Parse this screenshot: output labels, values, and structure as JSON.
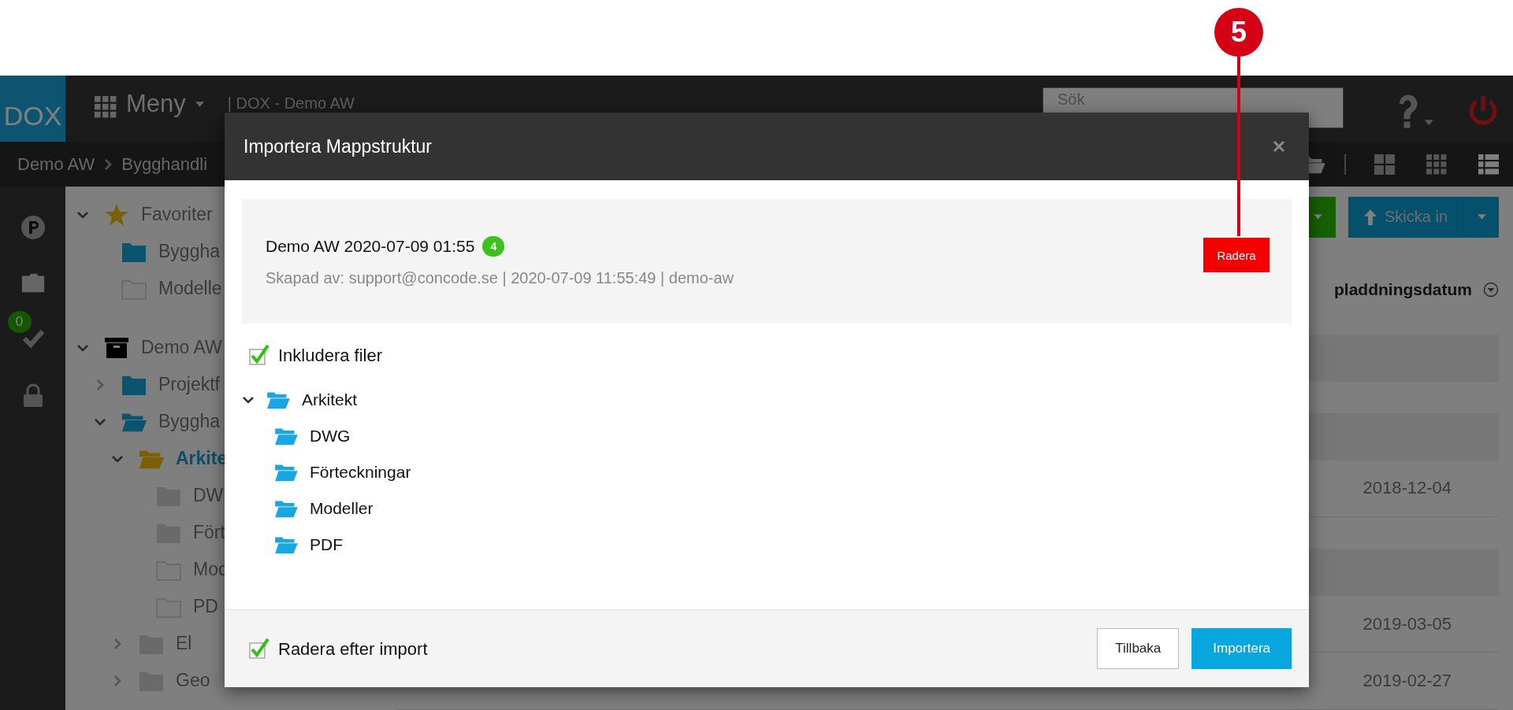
{
  "callout": {
    "label": "5"
  },
  "header": {
    "logo": "DOX",
    "menu": "Meny",
    "title": "| DOX - Demo AW",
    "search": {
      "placeholder": "Sök"
    }
  },
  "breadcrumb": [
    "Demo AW",
    "Bygghandli"
  ],
  "rail": {
    "badge": "0"
  },
  "tree": [
    {
      "name": "Favoriter",
      "kind": "favorites",
      "expanded": true,
      "selected": false,
      "children": [
        {
          "name": "Byggha",
          "kind": "folder-blue",
          "selected": false
        },
        {
          "name": "Modelle",
          "kind": "folder-empty",
          "selected": false
        }
      ]
    },
    {
      "name": "Demo AW",
      "kind": "archive",
      "expanded": true,
      "selected": false,
      "children": [
        {
          "name": "Projektf",
          "kind": "folder-blue",
          "expanded": false,
          "selected": false
        },
        {
          "name": "Byggha",
          "kind": "folder-blue",
          "expanded": true,
          "selected": false,
          "children": [
            {
              "name": "Arkite",
              "kind": "folder-gold",
              "expanded": true,
              "selected": true,
              "children": [
                {
                  "name": "DW",
                  "kind": "folder-grey",
                  "selected": false
                },
                {
                  "name": "Fört",
                  "kind": "folder-grey",
                  "selected": false
                },
                {
                  "name": "Mod",
                  "kind": "folder-empty",
                  "selected": false
                },
                {
                  "name": "PD",
                  "kind": "folder-empty",
                  "selected": false
                }
              ]
            },
            {
              "name": "El",
              "kind": "folder-grey",
              "expanded": false,
              "selected": false
            },
            {
              "name": "Geo",
              "kind": "folder-grey",
              "expanded": false,
              "selected": false
            }
          ]
        }
      ]
    }
  ],
  "toolbar": {
    "submit": "Skicka in"
  },
  "table": {
    "column": "pladdningsdatum",
    "rows": [
      {
        "kind": "group"
      },
      {
        "kind": "group"
      },
      {
        "kind": "file",
        "date": "2018-12-04"
      },
      {
        "kind": "group"
      },
      {
        "kind": "file",
        "date": "2019-03-05"
      },
      {
        "kind": "file",
        "date": "2019-02-27"
      }
    ]
  },
  "dialog": {
    "title": "Importera Mappstruktur",
    "import": {
      "name": "Demo AW 2020-07-09 01:55",
      "count": "4",
      "meta": "Skapad av: support@concode.se | 2020-07-09 11:55:49 | demo-aw",
      "delete": "Radera"
    },
    "include_files": {
      "label": "Inkludera filer",
      "checked": true
    },
    "folders": [
      {
        "name": "Arkitekt",
        "expanded": true,
        "children": [
          {
            "name": "DWG"
          },
          {
            "name": "Förteckningar"
          },
          {
            "name": "Modeller"
          },
          {
            "name": "PDF"
          }
        ]
      }
    ],
    "delete_after": {
      "label": "Radera efter import",
      "checked": true
    },
    "buttons": [
      {
        "label": "Tillbaka",
        "kind": "secondary"
      },
      {
        "label": "Importera",
        "kind": "primary"
      }
    ]
  }
}
